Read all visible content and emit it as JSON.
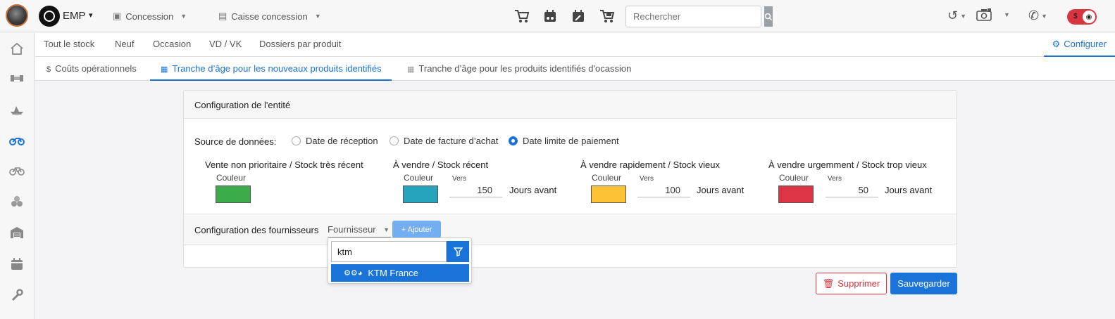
{
  "topbar": {
    "brand": "EMP",
    "dealership_select": "Concession",
    "cashdesk_select": "Caisse concession",
    "search_placeholder": "Rechercher",
    "icons": [
      "cart-icon",
      "calendar-moto-icon",
      "calendar-wrench-icon",
      "cart-moto-icon",
      "history-icon",
      "camera-icon",
      "phone-icon"
    ],
    "toggle_label": "$"
  },
  "sidebar": {
    "items": [
      "home-icon",
      "handshake-icon",
      "boat-icon",
      "motorcycle-icon",
      "bicycle-icon",
      "parts-icon",
      "warehouse-icon",
      "calendar-icon",
      "wrench-icon"
    ],
    "active": "motorcycle-icon"
  },
  "subnav": {
    "items": [
      "Tout le stock",
      "Neuf",
      "Occasion",
      "VD / VK",
      "Dossiers par produit"
    ],
    "configure": "Configurer"
  },
  "tabs": [
    {
      "label": "Coûts opérationnels",
      "icon": "dollar-icon"
    },
    {
      "label": "Tranche d’âge pour les nouveaux produits identifiés",
      "icon": "calendar-icon"
    },
    {
      "label": "Tranche d’âge pour les produits identifiés d'ocassion",
      "icon": "calendar-icon"
    }
  ],
  "panel": {
    "title": "Configuration de l'entité",
    "source_label": "Source de données:",
    "sources": [
      {
        "label": "Date de réception",
        "checked": false
      },
      {
        "label": "Date de facture d’achat",
        "checked": false
      },
      {
        "label": "Date limite de paiement",
        "checked": true
      }
    ],
    "categories": [
      {
        "title": "Vente non prioritaire / Stock très récent",
        "couleur": "Couleur",
        "color": "#3cab4a",
        "vers": "",
        "days": "",
        "jours": ""
      },
      {
        "title": "À vendre / Stock récent",
        "couleur": "Couleur",
        "color": "#26a3bd",
        "vers": "Vers",
        "days": "150",
        "jours": "Jours avant"
      },
      {
        "title": "À vendre rapidement / Stock vieux",
        "couleur": "Couleur",
        "color": "#fdc236",
        "vers": "Vers",
        "days": "100",
        "jours": "Jours avant"
      },
      {
        "title": "À vendre urgemment / Stock trop vieux",
        "couleur": "Couleur",
        "color": "#dc3646",
        "vers": "Vers",
        "days": "50",
        "jours": "Jours avant"
      }
    ],
    "suppliers_label": "Configuration des fournisseurs",
    "supplier_select": "Fournisseur",
    "add_button": "+ Ajouter"
  },
  "dropdown": {
    "search_value": "ktm",
    "option": "KTM France"
  },
  "actions": {
    "delete": "Supprimer",
    "save": "Sauvegarder"
  },
  "colors": {
    "accent": "#1a73d9",
    "danger": "#d9343f"
  }
}
